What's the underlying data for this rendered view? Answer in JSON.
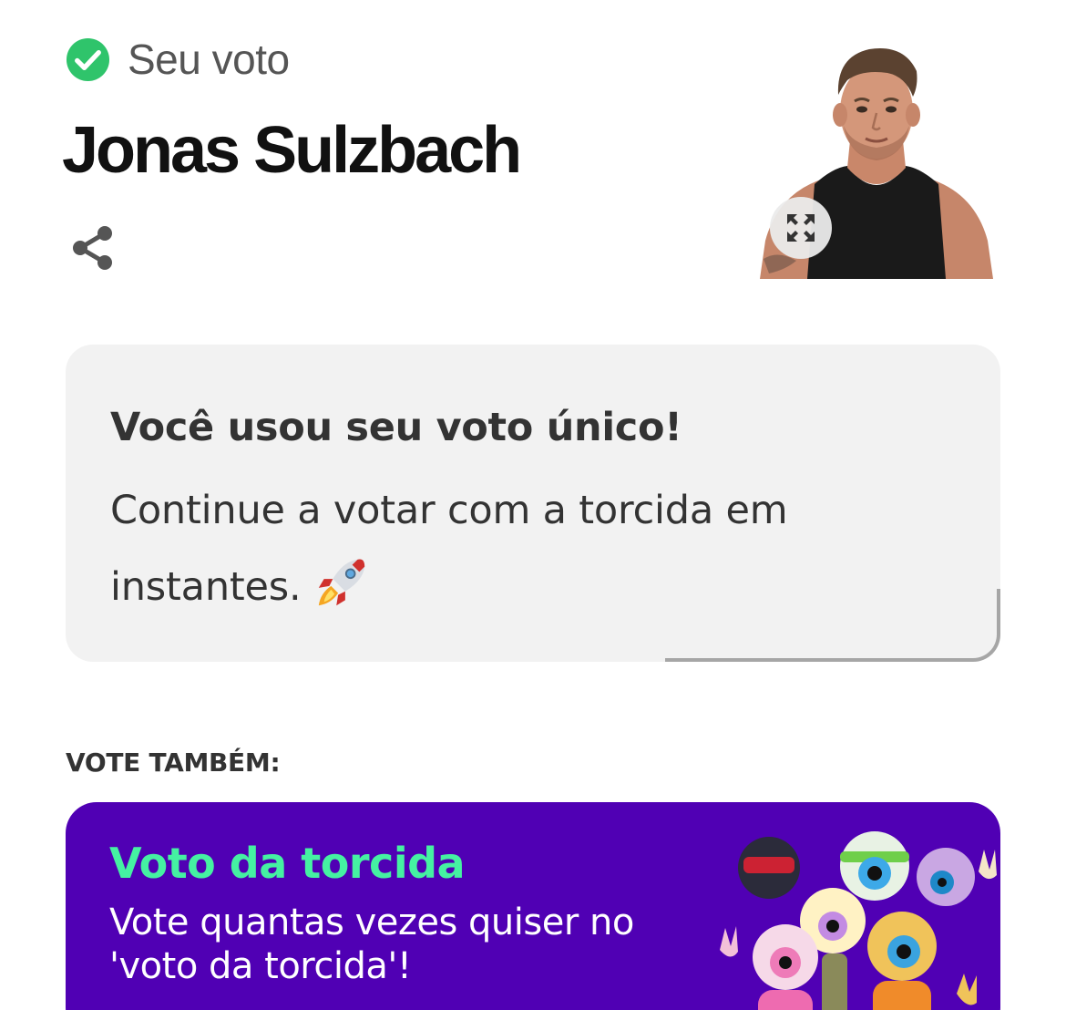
{
  "vote": {
    "status_label": "Seu voto",
    "candidate_name": "Jonas Sulzbach"
  },
  "icons": {
    "check": "check-circle-icon",
    "share": "share-icon",
    "expand": "expand-icon",
    "rocket": "rocket-icon"
  },
  "notice": {
    "title": "Você usou seu voto único!",
    "message": "Continue a votar com a torcida em instantes."
  },
  "also_vote": {
    "heading": "VOTE TAMBÉM:"
  },
  "promo": {
    "title": "Voto da torcida",
    "description": "Vote quantas vezes quiser no 'voto da torcida'!"
  },
  "colors": {
    "check_green": "#2fc46b",
    "card_gray": "#f2f2f2",
    "promo_purple": "#5000b4",
    "promo_title_green": "#45f1a2"
  }
}
